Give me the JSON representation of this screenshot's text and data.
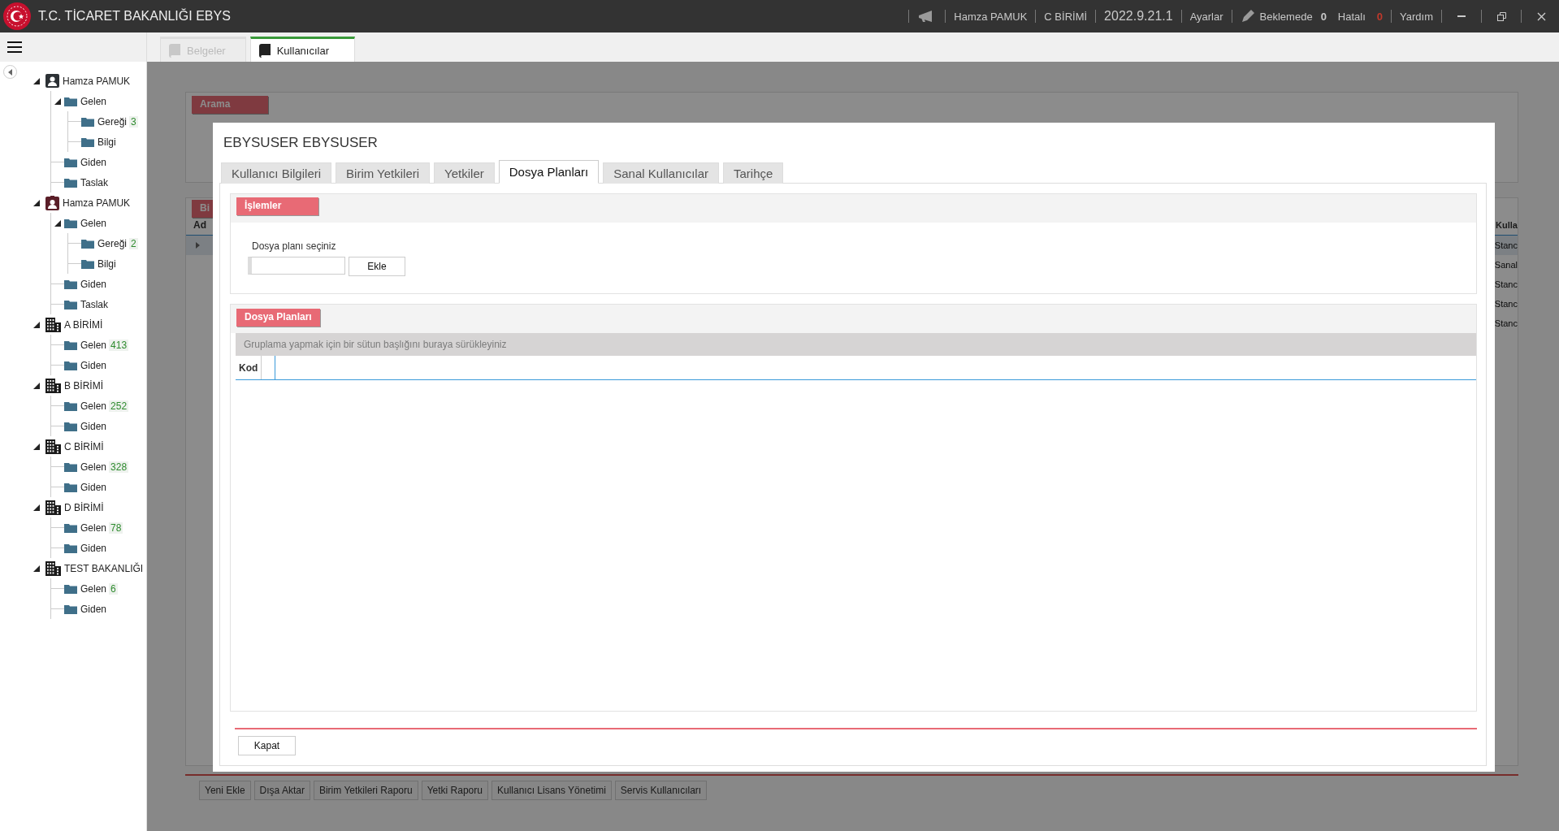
{
  "window": {
    "title": "T.C. TİCARET BAKANLIĞI EBYS"
  },
  "header": {
    "user": "Hamza PAMUK",
    "unit": "C BİRİMİ",
    "version": "2022.9.21.1",
    "settings": "Ayarlar",
    "pending_label": "Beklemede",
    "pending_count": "0",
    "error_label": "Hatalı",
    "error_count": "0",
    "help": "Yardım"
  },
  "doc_tabs": [
    {
      "label": "Belgeler",
      "selected": false,
      "disabled": true
    },
    {
      "label": "Kullanıcılar",
      "selected": true,
      "disabled": false
    }
  ],
  "sidebar": {
    "tree": [
      {
        "label": "Hamza PAMUK",
        "kind": "user",
        "expanded": true,
        "children": [
          {
            "label": "Gelen",
            "kind": "folder",
            "expanded": true,
            "children": [
              {
                "label": "Gereği",
                "kind": "folder",
                "count": "3"
              },
              {
                "label": "Bilgi",
                "kind": "folder"
              }
            ]
          },
          {
            "label": "Giden",
            "kind": "folder"
          },
          {
            "label": "Taslak",
            "kind": "folder"
          }
        ]
      },
      {
        "label": "Hamza PAMUK",
        "kind": "badge-user",
        "expanded": true,
        "children": [
          {
            "label": "Gelen",
            "kind": "folder",
            "expanded": true,
            "children": [
              {
                "label": "Gereği",
                "kind": "folder",
                "count": "2"
              },
              {
                "label": "Bilgi",
                "kind": "folder"
              }
            ]
          },
          {
            "label": "Giden",
            "kind": "folder"
          },
          {
            "label": "Taslak",
            "kind": "folder"
          }
        ]
      },
      {
        "label": "A BİRİMİ",
        "kind": "building",
        "expanded": true,
        "children": [
          {
            "label": "Gelen",
            "kind": "folder",
            "count": "413"
          },
          {
            "label": "Giden",
            "kind": "folder"
          }
        ]
      },
      {
        "label": "B BİRİMİ",
        "kind": "building",
        "expanded": true,
        "children": [
          {
            "label": "Gelen",
            "kind": "folder",
            "count": "252"
          },
          {
            "label": "Giden",
            "kind": "folder"
          }
        ]
      },
      {
        "label": "C BİRİMİ",
        "kind": "building",
        "expanded": true,
        "children": [
          {
            "label": "Gelen",
            "kind": "folder",
            "count": "328"
          },
          {
            "label": "Giden",
            "kind": "folder"
          }
        ]
      },
      {
        "label": "D BİRİMİ",
        "kind": "building",
        "expanded": true,
        "children": [
          {
            "label": "Gelen",
            "kind": "folder",
            "count": "78"
          },
          {
            "label": "Giden",
            "kind": "folder"
          }
        ]
      },
      {
        "label": "TEST BAKANLIĞI",
        "kind": "building",
        "expanded": true,
        "children": [
          {
            "label": "Gelen",
            "kind": "folder",
            "count": "6"
          },
          {
            "label": "Giden",
            "kind": "folder"
          }
        ]
      }
    ]
  },
  "background": {
    "search_panel": {
      "title": "Arama"
    },
    "list_panel": {
      "title": "Bi",
      "columns": [
        "Ad",
        "Kulla"
      ],
      "rows": [
        "Stanc",
        "Sanal",
        "Stanc",
        "Stanc",
        "Stanc"
      ]
    },
    "buttons": [
      "Yeni Ekle",
      "Dışa Aktar",
      "Birim Yetkileri Raporu",
      "Yetki Raporu",
      "Kullanıcı Lisans Yönetimi",
      "Servis Kullanıcıları"
    ]
  },
  "dialog": {
    "title": "EBYSUSER EBYSUSER",
    "tabs": [
      {
        "label": "Kullanıcı Bilgileri",
        "selected": false
      },
      {
        "label": "Birim Yetkileri",
        "selected": false
      },
      {
        "label": "Yetkiler",
        "selected": false
      },
      {
        "label": "Dosya Planları",
        "selected": true
      },
      {
        "label": "Sanal Kullanıcılar",
        "selected": false
      },
      {
        "label": "Tarihçe",
        "selected": false
      }
    ],
    "operations": {
      "title": "İşlemler",
      "field_label": "Dosya planı seçiniz",
      "add_button": "Ekle"
    },
    "plans": {
      "title": "Dosya Planları",
      "group_hint": "Gruplama yapmak için bir sütun başlığını buraya sürükleyiniz",
      "columns": [
        "Kod"
      ]
    },
    "close_button": "Kapat"
  }
}
